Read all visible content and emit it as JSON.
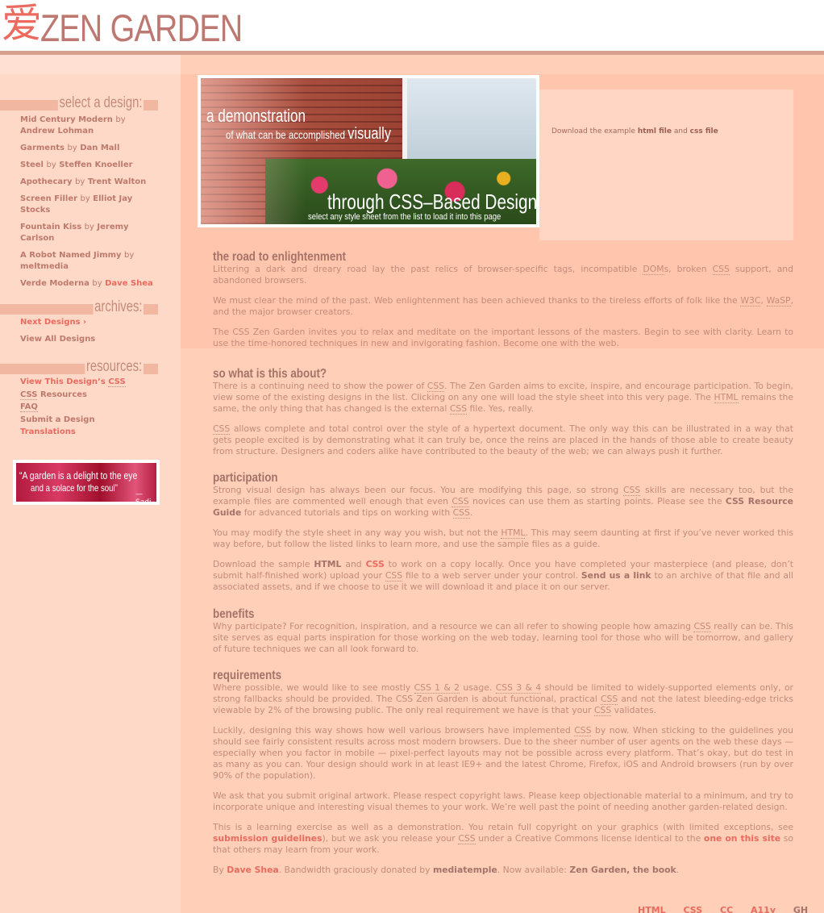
{
  "header": {
    "logo_glyph": "爱",
    "logo_text": "ZEN GARDEN"
  },
  "sidebar": {
    "select_heading": "select a design:",
    "designs": [
      {
        "name": "Mid Century Modern",
        "by": "by",
        "author": "Andrew Lohman"
      },
      {
        "name": "Garments",
        "by": "by",
        "author": "Dan Mall"
      },
      {
        "name": "Steel",
        "by": "by",
        "author": "Steffen Knoeller"
      },
      {
        "name": "Apothecary",
        "by": "by",
        "author": "Trent Walton"
      },
      {
        "name": "Screen Filler",
        "by": "by",
        "author": "Elliot Jay Stocks"
      },
      {
        "name": "Fountain Kiss",
        "by": "by",
        "author": "Jeremy Carlson"
      },
      {
        "name": "A Robot Named Jimmy",
        "by": "by",
        "author": "meltmedia"
      },
      {
        "name": "Verde Moderna",
        "by": "by",
        "author": "Dave Shea"
      }
    ],
    "archives_heading": "archives:",
    "archives": {
      "next": "Next Designs ›",
      "view_all": "View All Designs"
    },
    "resources_heading": "resources:",
    "resources": {
      "view_css_prefix": "View This Design’s ",
      "view_css_abbr": "CSS",
      "css_res_abbr": "CSS",
      "css_res_suffix": " Resources",
      "faq": "FAQ",
      "submit": "Submit a Design",
      "translations": "Translations"
    },
    "quote": {
      "line1": "“A garden is a delight to the eye",
      "line2": "and a solace for the soul”",
      "attribution": "— Sadi"
    }
  },
  "hero": {
    "line1": "a demonstration",
    "line2_prefix": "of what can be accomplished ",
    "line2_big": "visually",
    "line3": "through CSS–Based Design",
    "line4": "select any style sheet from the list to load it into this page"
  },
  "download": {
    "prefix": "Download the example ",
    "html_link": "html file",
    "and": " and ",
    "css_link": "css file"
  },
  "sections": {
    "road": {
      "title": "the road to enlightenment",
      "p1a": "Littering a dark and dreary road lay the past relics of browser-specific tags, incompatible ",
      "p1_doms": "DOM",
      "p1b": "s, broken ",
      "p1_css": "CSS",
      "p1c": " support, and abandoned browsers.",
      "p2a": "We must clear the mind of the past. Web enlightenment has been achieved thanks to the tireless efforts of folk like the ",
      "p2_w3c": "W3C",
      "p2b": ", ",
      "p2_wasp": "WaSP",
      "p2c": ", and the major browser creators.",
      "p3": "The CSS Zen Garden invites you to relax and meditate on the important lessons of the masters. Begin to see with clarity. Learn to use the time-honored techniques in new and invigorating fashion. Become one with the web."
    },
    "about": {
      "title": "so what is this about?",
      "p1a": "There is a continuing need to show the power of ",
      "p1_css": "CSS",
      "p1b": ". The Zen Garden aims to excite, inspire, and encourage participation. To begin, view some of the existing designs in the list. Clicking on any one will load the style sheet into this very page. The ",
      "p1_html": "HTML",
      "p1c": " remains the same, the only thing that has changed is the external ",
      "p1_css2": "CSS",
      "p1d": " file. Yes, really.",
      "p2_css": "CSS",
      "p2": " allows complete and total control over the style of a hypertext document. The only way this can be illustrated in a way that gets people excited is by demonstrating what it can truly be, once the reins are placed in the hands of those able to create beauty from structure. Designers and coders alike have contributed to the beauty of the web; we can always push it further."
    },
    "participation": {
      "title": "participation",
      "p1a": "Strong visual design has always been our focus. You are modifying this page, so strong ",
      "p1_css": "CSS",
      "p1b": " skills are necessary too, but the example files are commented well enough that even ",
      "p1_css2": "CSS",
      "p1c": " novices can use them as starting points. Please see the ",
      "p1_link": "CSS Resource Guide",
      "p1d": " for advanced tutorials and tips on working with ",
      "p1_css3": "CSS",
      "p1e": ".",
      "p2a": "You may modify the style sheet in any way you wish, but not the ",
      "p2_html": "HTML",
      "p2b": ". This may seem daunting at first if you’ve never worked this way before, but follow the listed links to learn more, and use the sample files as a guide.",
      "p3a": "Download the sample ",
      "p3_html": "HTML",
      "p3b": " and ",
      "p3_css": "CSS",
      "p3c": " to work on a copy locally. Once you have completed your masterpiece (and please, don’t submit half-finished work) upload your ",
      "p3_css2": "CSS",
      "p3d": " file to a web server under your control. ",
      "p3_link": "Send us a link",
      "p3e": " to an archive of that file and all associated assets, and if we choose to use it we will download it and place it on our server."
    },
    "benefits": {
      "title": "benefits",
      "p1a": "Why participate? For recognition, inspiration, and a resource we can all refer to showing people how amazing ",
      "p1_css": "CSS",
      "p1b": " really can be. This site serves as equal parts inspiration for those working on the web today, learning tool for those who will be tomorrow, and gallery of future techniques we can all look forward to."
    },
    "requirements": {
      "title": "requirements",
      "p1a": "Where possible, we would like to see mostly ",
      "p1_css12": "CSS 1 & 2",
      "p1b": " usage. ",
      "p1_css34": "CSS 3 & 4",
      "p1c": " should be limited to widely-supported elements only, or strong fallbacks should be provided. The CSS Zen Garden is about functional, practical ",
      "p1_css": "CSS",
      "p1d": " and not the latest bleeding-edge tricks viewable by 2% of the browsing public. The only real requirement we have is that your ",
      "p1_css2": "CSS",
      "p1e": " validates.",
      "p2a": "Luckily, designing this way shows how well various browsers have implemented ",
      "p2_css": "CSS",
      "p2b": " by now. When sticking to the guidelines you should see fairly consistent results across most modern browsers. Due to the sheer number of user agents on the web these days — especially when you factor in mobile — pixel-perfect layouts may not be possible across every platform. That’s okay, but do test in as many as you can. Your design should work in at least IE9+ and the latest Chrome, Firefox, iOS and Android browsers (run by over 90% of the population).",
      "p3": "We ask that you submit original artwork. Please respect copyright laws. Please keep objectionable material to a minimum, and try to incorporate unique and interesting visual themes to your work. We’re well past the point of needing another garden-related design.",
      "p4a": "This is a learning exercise as well as a demonstration. You retain full copyright on your graphics (with limited exceptions, see ",
      "p4_link1": "submission guidelines",
      "p4b": "), but we ask you release your ",
      "p4_css": "CSS",
      "p4c": " under a Creative Commons license identical to the ",
      "p4_link2": "one on this site",
      "p4d": " so that others may learn from your work.",
      "p5a": "By ",
      "p5_author": "Dave Shea",
      "p5b": ". Bandwidth graciously donated by ",
      "p5_host": "mediatemple",
      "p5c": ". Now available: ",
      "p5_book": "Zen Garden, the book",
      "p5d": "."
    }
  },
  "footer": {
    "html": "HTML",
    "css": "CSS",
    "cc": "CC",
    "a11y": "A11y",
    "gh": "GH"
  },
  "colors": {
    "background": "#ffcfb8",
    "sidebar": "#ffd9c8",
    "accent": "#e96b5f",
    "text": "#c48b7a",
    "heading": "#a6736a"
  }
}
